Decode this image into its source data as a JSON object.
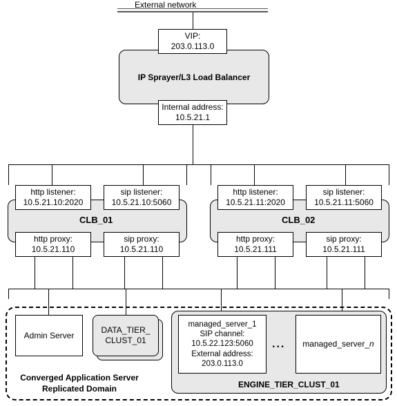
{
  "external_network_label": "External network",
  "lb": {
    "vip_label": "VIP:",
    "vip_value": "203.0.113.0",
    "title": "IP Sprayer/L3 Load Balancer",
    "internal_label": "Internal address:",
    "internal_value": "10.5.21.1"
  },
  "clb": [
    {
      "name": "CLB_01",
      "http_listener": {
        "label": "http listener:",
        "value": "10.5.21.10:2020"
      },
      "sip_listener": {
        "label": "sip listener:",
        "value": "10.5.21.10:5060"
      },
      "http_proxy": {
        "label": "http proxy:",
        "value": "10.5.21.110"
      },
      "sip_proxy": {
        "label": "sip proxy:",
        "value": "10.5.21.110"
      }
    },
    {
      "name": "CLB_02",
      "http_listener": {
        "label": "http listener:",
        "value": "10.5.21.11:2020"
      },
      "sip_listener": {
        "label": "sip listener:",
        "value": "10.5.21.11:5060"
      },
      "http_proxy": {
        "label": "http proxy:",
        "value": "10.5.21.111"
      },
      "sip_proxy": {
        "label": "sip proxy:",
        "value": "10.5.21.111"
      }
    }
  ],
  "domain": {
    "label_line1": "Converged Application Server",
    "label_line2": "Replicated Domain",
    "admin_server": "Admin Server",
    "data_tier_line1": "DATA_TIER_",
    "data_tier_line2": "CLUST_01",
    "engine_tier_label": "ENGINE_TIER_CLUST_01",
    "managed_server_1": {
      "name": "managed_server_1",
      "sip_channel_label": "SIP channel:",
      "sip_channel_value": "10.5.22.123:5060",
      "ext_addr_label": "External address:",
      "ext_addr_value": "203.0.113.0"
    },
    "managed_server_n_prefix": "managed_server_",
    "managed_server_n_suffix": "n",
    "ellipsis": "..."
  }
}
